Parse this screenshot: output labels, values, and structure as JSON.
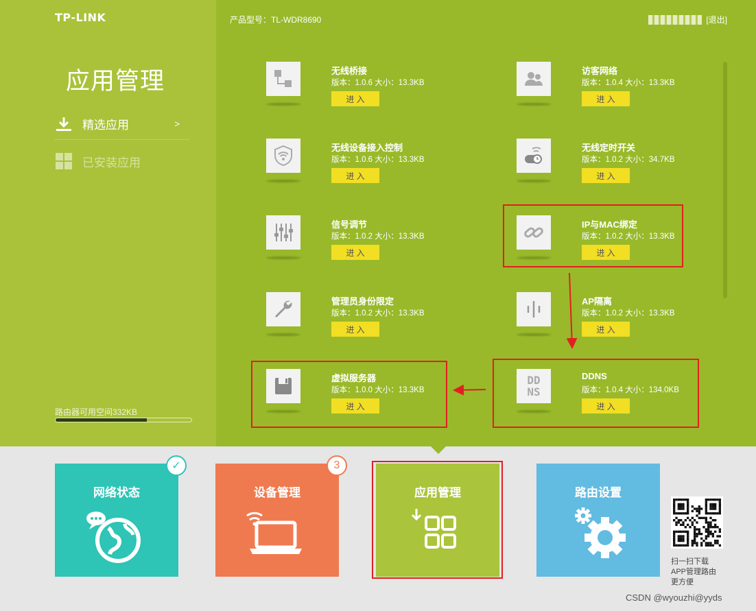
{
  "header": {
    "brand": "TP-LINK",
    "model_label": "产品型号：TL-WDR8690",
    "logout": "[退出]"
  },
  "sidebar": {
    "title": "应用管理",
    "items": [
      {
        "label": "精选应用",
        "arrow": ">"
      },
      {
        "label": "已安装应用"
      }
    ],
    "storage_label": "路由器可用空间332KB",
    "storage_used_fraction": 0.67
  },
  "apps": [
    {
      "name": "无线桥接",
      "meta": "版本：1.0.6 大小：13.3KB",
      "enter": "进 入",
      "icon": "bridge-icon"
    },
    {
      "name": "访客网络",
      "meta": "版本：1.0.4 大小：13.3KB",
      "enter": "进 入",
      "icon": "guest-users-icon"
    },
    {
      "name": "无线设备接入控制",
      "meta": "版本：1.0.6 大小：13.3KB",
      "enter": "进 入",
      "icon": "wifi-shield-icon"
    },
    {
      "name": "无线定时开关",
      "meta": "版本：1.0.2 大小：34.7KB",
      "enter": "进 入",
      "icon": "wifi-timer-icon"
    },
    {
      "name": "信号调节",
      "meta": "版本：1.0.2 大小：13.3KB",
      "enter": "进 入",
      "icon": "sliders-icon"
    },
    {
      "name": "IP与MAC绑定",
      "meta": "版本：1.0.2 大小：13.3KB",
      "enter": "进 入",
      "icon": "link-icon"
    },
    {
      "name": "管理员身份限定",
      "meta": "版本：1.0.2 大小：13.3KB",
      "enter": "进 入",
      "icon": "wrench-icon"
    },
    {
      "name": "AP隔离",
      "meta": "版本：1.0.2 大小：13.3KB",
      "enter": "进 入",
      "icon": "ap-isolation-icon"
    },
    {
      "name": "虚拟服务器",
      "meta": "版本：1.0.0 大小：13.3KB",
      "enter": "进 入",
      "icon": "floppy-icon"
    },
    {
      "name": "DDNS",
      "meta": "版本：1.0.4 大小：134.0KB",
      "enter": "进 入",
      "icon": "ddns-icon",
      "icon_text": "DD\nNS"
    }
  ],
  "tiles": [
    {
      "label": "网络状态",
      "icon": "globe-chat-icon",
      "badge_icon": "check-icon"
    },
    {
      "label": "设备管理",
      "icon": "laptop-wifi-icon",
      "badge": "3"
    },
    {
      "label": "应用管理",
      "icon": "apps-grid-icon"
    },
    {
      "label": "路由设置",
      "icon": "gears-icon"
    }
  ],
  "qr_caption": [
    "扫一扫下载",
    "APP管理路由",
    "更方便"
  ],
  "watermark": "CSDN @wyouzhi@yyds",
  "colors": {
    "sidebar_bg": "#a9c23a",
    "main_bg": "#99b92a",
    "enter_button": "#f2de23",
    "highlight_box": "#e02020",
    "tile_network": "#2ec4b6",
    "tile_device": "#f07a50",
    "tile_apps": "#aac43b",
    "tile_router": "#62bbe0"
  }
}
